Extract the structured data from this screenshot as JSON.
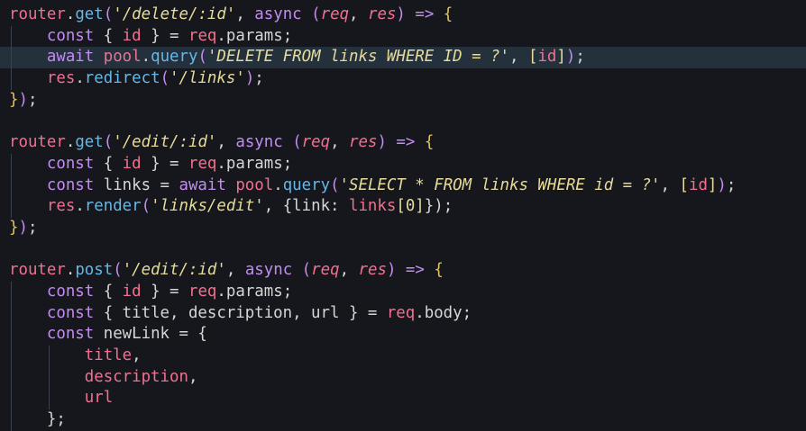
{
  "editor": {
    "lines": [
      {
        "highlight": false,
        "guides": 0,
        "tokens": [
          {
            "t": "router",
            "c": "var"
          },
          {
            "t": ".",
            "c": "plain"
          },
          {
            "t": "get",
            "c": "fn"
          },
          {
            "t": "(",
            "c": "paren"
          },
          {
            "t": "'/delete/:id'",
            "c": "str"
          },
          {
            "t": ", ",
            "c": "plain"
          },
          {
            "t": "async",
            "c": "kw"
          },
          {
            "t": " ",
            "c": "plain"
          },
          {
            "t": "(",
            "c": "paren"
          },
          {
            "t": "req",
            "c": "param"
          },
          {
            "t": ", ",
            "c": "plain"
          },
          {
            "t": "res",
            "c": "param"
          },
          {
            "t": ")",
            "c": "paren"
          },
          {
            "t": " => ",
            "c": "kw"
          },
          {
            "t": "{",
            "c": "brace"
          }
        ]
      },
      {
        "highlight": false,
        "guides": 1,
        "tokens": [
          {
            "t": "    ",
            "c": "plain"
          },
          {
            "t": "const",
            "c": "kw"
          },
          {
            "t": " { ",
            "c": "plain"
          },
          {
            "t": "id",
            "c": "var"
          },
          {
            "t": " } = ",
            "c": "plain"
          },
          {
            "t": "req",
            "c": "var"
          },
          {
            "t": ".params;",
            "c": "plain"
          }
        ]
      },
      {
        "highlight": true,
        "guides": 1,
        "tokens": [
          {
            "t": "    ",
            "c": "plain"
          },
          {
            "t": "await",
            "c": "kw"
          },
          {
            "t": " ",
            "c": "plain"
          },
          {
            "t": "pool",
            "c": "var"
          },
          {
            "t": ".",
            "c": "plain"
          },
          {
            "t": "query",
            "c": "fn"
          },
          {
            "t": "(",
            "c": "paren"
          },
          {
            "t": "'DELETE FROM links WHERE ID = ?'",
            "c": "str"
          },
          {
            "t": ", ",
            "c": "plain"
          },
          {
            "t": "[",
            "c": "bracket"
          },
          {
            "t": "id",
            "c": "var"
          },
          {
            "t": "]",
            "c": "bracket"
          },
          {
            "t": ")",
            "c": "paren"
          },
          {
            "t": ";",
            "c": "plain"
          }
        ]
      },
      {
        "highlight": false,
        "guides": 1,
        "tokens": [
          {
            "t": "    ",
            "c": "plain"
          },
          {
            "t": "res",
            "c": "var"
          },
          {
            "t": ".",
            "c": "plain"
          },
          {
            "t": "redirect",
            "c": "fn"
          },
          {
            "t": "(",
            "c": "paren"
          },
          {
            "t": "'/links'",
            "c": "str"
          },
          {
            "t": ")",
            "c": "paren"
          },
          {
            "t": ";",
            "c": "plain"
          }
        ]
      },
      {
        "highlight": false,
        "guides": 0,
        "tokens": [
          {
            "t": "}",
            "c": "brace"
          },
          {
            "t": ")",
            "c": "paren"
          },
          {
            "t": ";",
            "c": "plain"
          }
        ]
      },
      {
        "highlight": false,
        "guides": 0,
        "tokens": []
      },
      {
        "highlight": false,
        "guides": 0,
        "tokens": [
          {
            "t": "router",
            "c": "var"
          },
          {
            "t": ".",
            "c": "plain"
          },
          {
            "t": "get",
            "c": "fn"
          },
          {
            "t": "(",
            "c": "paren"
          },
          {
            "t": "'/edit/:id'",
            "c": "str"
          },
          {
            "t": ", ",
            "c": "plain"
          },
          {
            "t": "async",
            "c": "kw"
          },
          {
            "t": " ",
            "c": "plain"
          },
          {
            "t": "(",
            "c": "paren"
          },
          {
            "t": "req",
            "c": "param"
          },
          {
            "t": ", ",
            "c": "plain"
          },
          {
            "t": "res",
            "c": "param"
          },
          {
            "t": ")",
            "c": "paren"
          },
          {
            "t": " => ",
            "c": "kw"
          },
          {
            "t": "{",
            "c": "brace"
          }
        ]
      },
      {
        "highlight": false,
        "guides": 1,
        "tokens": [
          {
            "t": "    ",
            "c": "plain"
          },
          {
            "t": "const",
            "c": "kw"
          },
          {
            "t": " { ",
            "c": "plain"
          },
          {
            "t": "id",
            "c": "var"
          },
          {
            "t": " } = ",
            "c": "plain"
          },
          {
            "t": "req",
            "c": "var"
          },
          {
            "t": ".params;",
            "c": "plain"
          }
        ]
      },
      {
        "highlight": false,
        "guides": 1,
        "tokens": [
          {
            "t": "    ",
            "c": "plain"
          },
          {
            "t": "const",
            "c": "kw"
          },
          {
            "t": " links = ",
            "c": "plain"
          },
          {
            "t": "await",
            "c": "kw"
          },
          {
            "t": " ",
            "c": "plain"
          },
          {
            "t": "pool",
            "c": "var"
          },
          {
            "t": ".",
            "c": "plain"
          },
          {
            "t": "query",
            "c": "fn"
          },
          {
            "t": "(",
            "c": "paren"
          },
          {
            "t": "'SELECT * FROM links WHERE id = ?'",
            "c": "str"
          },
          {
            "t": ", ",
            "c": "plain"
          },
          {
            "t": "[",
            "c": "bracket"
          },
          {
            "t": "id",
            "c": "var"
          },
          {
            "t": "]",
            "c": "bracket"
          },
          {
            "t": ")",
            "c": "paren"
          },
          {
            "t": ";",
            "c": "plain"
          }
        ]
      },
      {
        "highlight": false,
        "guides": 1,
        "tokens": [
          {
            "t": "    ",
            "c": "plain"
          },
          {
            "t": "res",
            "c": "var"
          },
          {
            "t": ".",
            "c": "plain"
          },
          {
            "t": "render",
            "c": "fn"
          },
          {
            "t": "(",
            "c": "paren"
          },
          {
            "t": "'links/edit'",
            "c": "str"
          },
          {
            "t": ", {link: ",
            "c": "plain"
          },
          {
            "t": "links",
            "c": "var"
          },
          {
            "t": "[0]",
            "c": "bracket"
          },
          {
            "t": "})",
            "c": "plain"
          },
          {
            "t": ";",
            "c": "plain"
          }
        ]
      },
      {
        "highlight": false,
        "guides": 0,
        "tokens": [
          {
            "t": "}",
            "c": "brace"
          },
          {
            "t": ")",
            "c": "paren"
          },
          {
            "t": ";",
            "c": "plain"
          }
        ]
      },
      {
        "highlight": false,
        "guides": 0,
        "tokens": []
      },
      {
        "highlight": false,
        "guides": 0,
        "tokens": [
          {
            "t": "router",
            "c": "var"
          },
          {
            "t": ".",
            "c": "plain"
          },
          {
            "t": "post",
            "c": "fn"
          },
          {
            "t": "(",
            "c": "paren"
          },
          {
            "t": "'/edit/:id'",
            "c": "str"
          },
          {
            "t": ", ",
            "c": "plain"
          },
          {
            "t": "async",
            "c": "kw"
          },
          {
            "t": " ",
            "c": "plain"
          },
          {
            "t": "(",
            "c": "paren"
          },
          {
            "t": "req",
            "c": "param"
          },
          {
            "t": ", ",
            "c": "plain"
          },
          {
            "t": "res",
            "c": "param"
          },
          {
            "t": ")",
            "c": "paren"
          },
          {
            "t": " => ",
            "c": "kw"
          },
          {
            "t": "{",
            "c": "brace"
          }
        ]
      },
      {
        "highlight": false,
        "guides": 1,
        "tokens": [
          {
            "t": "    ",
            "c": "plain"
          },
          {
            "t": "const",
            "c": "kw"
          },
          {
            "t": " { ",
            "c": "plain"
          },
          {
            "t": "id",
            "c": "var"
          },
          {
            "t": " } = ",
            "c": "plain"
          },
          {
            "t": "req",
            "c": "var"
          },
          {
            "t": ".params;",
            "c": "plain"
          }
        ]
      },
      {
        "highlight": false,
        "guides": 1,
        "tokens": [
          {
            "t": "    ",
            "c": "plain"
          },
          {
            "t": "const",
            "c": "kw"
          },
          {
            "t": " { title, description, url } = ",
            "c": "plain"
          },
          {
            "t": "req",
            "c": "var"
          },
          {
            "t": ".body;",
            "c": "plain"
          }
        ]
      },
      {
        "highlight": false,
        "guides": 1,
        "tokens": [
          {
            "t": "    ",
            "c": "plain"
          },
          {
            "t": "const",
            "c": "kw"
          },
          {
            "t": " newLink = {",
            "c": "plain"
          }
        ]
      },
      {
        "highlight": false,
        "guides": 2,
        "tokens": [
          {
            "t": "        ",
            "c": "plain"
          },
          {
            "t": "title",
            "c": "var"
          },
          {
            "t": ",",
            "c": "plain"
          }
        ]
      },
      {
        "highlight": false,
        "guides": 2,
        "tokens": [
          {
            "t": "        ",
            "c": "plain"
          },
          {
            "t": "description",
            "c": "var"
          },
          {
            "t": ",",
            "c": "plain"
          }
        ]
      },
      {
        "highlight": false,
        "guides": 2,
        "tokens": [
          {
            "t": "        ",
            "c": "plain"
          },
          {
            "t": "url",
            "c": "var"
          }
        ]
      },
      {
        "highlight": false,
        "guides": 1,
        "tokens": [
          {
            "t": "    ",
            "c": "plain"
          },
          {
            "t": "};",
            "c": "plain"
          }
        ]
      }
    ]
  },
  "theme": {
    "background": "#15171c",
    "highlight_line": "#24313c",
    "variable": "#f0718f",
    "function": "#63b8e8",
    "keyword": "#c38cf0",
    "string": "#e6db9a",
    "plain": "#d6d6d6"
  }
}
